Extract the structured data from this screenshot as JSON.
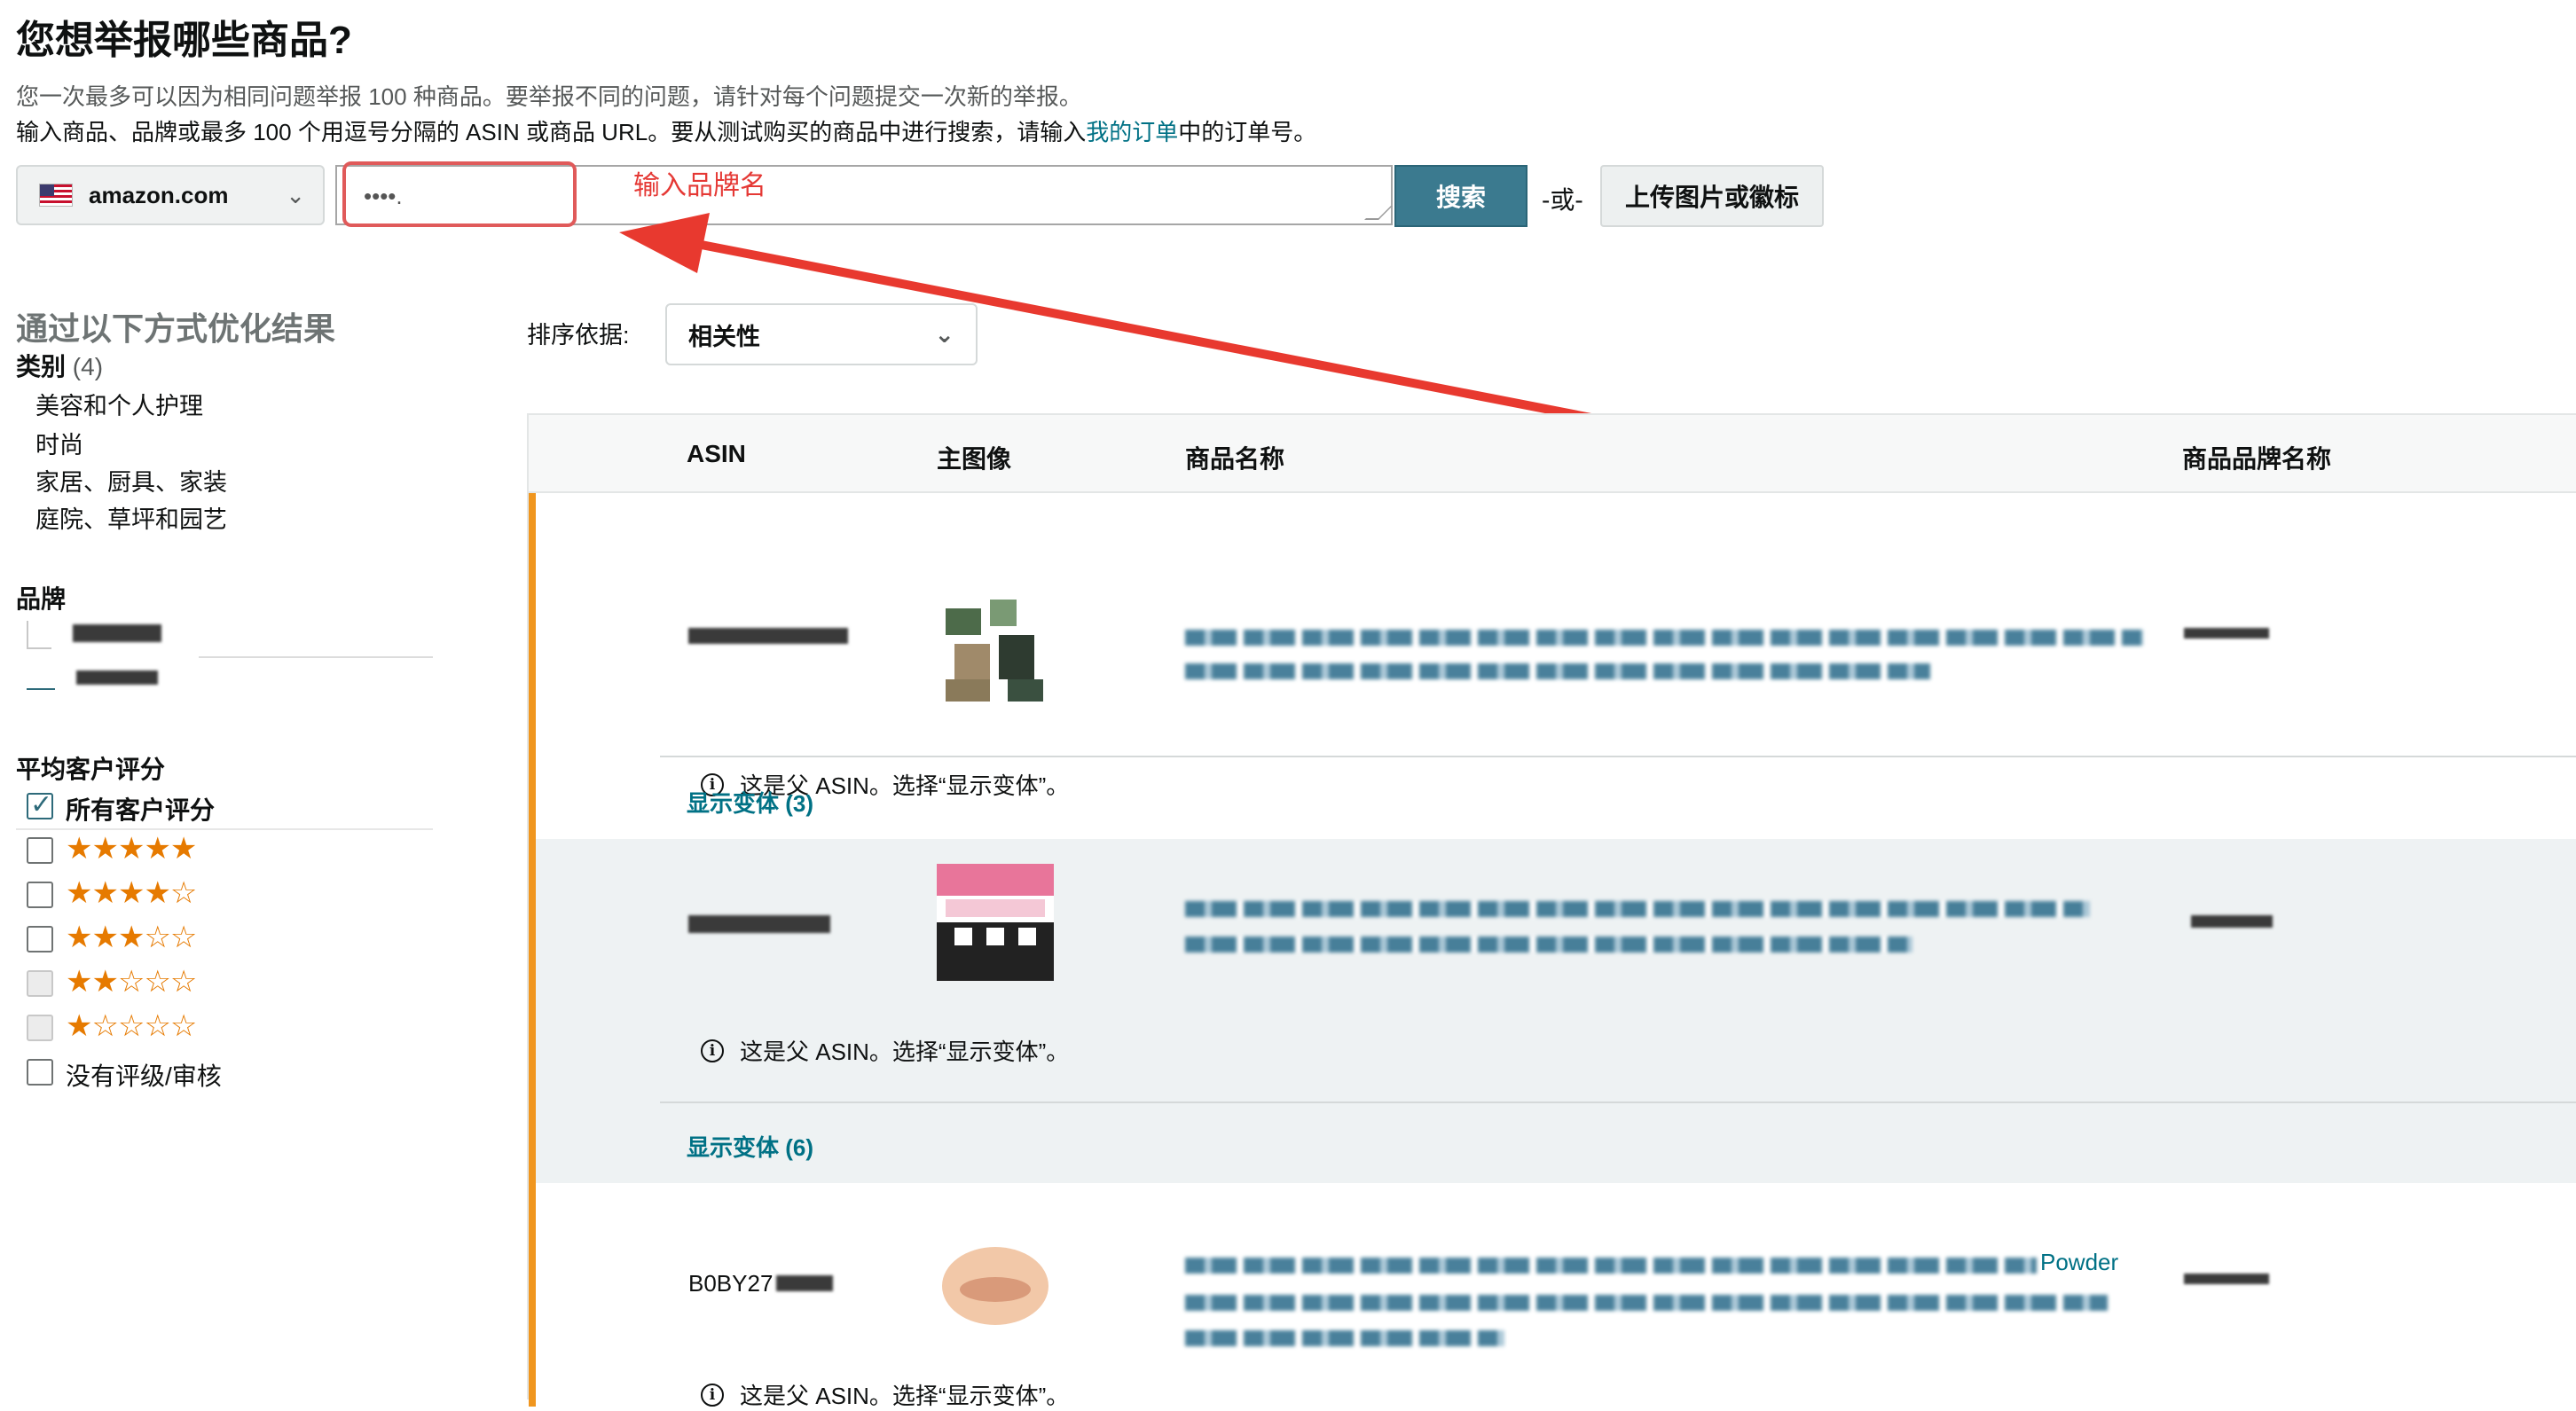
{
  "header": {
    "title": "您想举报哪些商品?",
    "desc1": "您一次最多可以因为相同问题举报 100 种商品。要举报不同的问题，请针对每个问题提交一次新的举报。",
    "desc2_pre": "输入商品、品牌或最多 100 个用逗号分隔的 ASIN 或商品 URL。要从测试购买的商品中进行搜索，请输入",
    "desc2_link": "我的订单",
    "desc2_post": "中的订单号。"
  },
  "search": {
    "marketplace": "amazon.com",
    "query": "••••.",
    "annotation": "输入品牌名",
    "search_label": "搜索",
    "or_label": "-或-",
    "upload_label": "上传图片或徽标"
  },
  "sidebar": {
    "refine_title": "通过以下方式优化结果",
    "category_heading": "类别",
    "category_count": "(4)",
    "categories": [
      "美容和个人护理",
      "时尚",
      "家居、厨具、家装",
      "庭院、草坪和园艺"
    ],
    "brand_heading": "品牌",
    "rating_heading": "平均客户评分",
    "all_ratings": "所有客户评分",
    "rating_stars": [
      "★★★★★",
      "★★★★☆",
      "★★★☆☆",
      "★★☆☆☆",
      "★☆☆☆☆"
    ],
    "no_rating": "没有评级/审核"
  },
  "sort": {
    "label": "排序依据:",
    "value": "相关性"
  },
  "table": {
    "columns": [
      "ASIN",
      "主图像",
      "商品名称",
      "商品品牌名称"
    ],
    "parent_note": "这是父 ASIN。选择“显示变体”。",
    "rows": [
      {
        "asin": "",
        "variants": "显示变体 (3)"
      },
      {
        "asin": "",
        "variants": "显示变体 (6)"
      },
      {
        "asin": "B0BY27",
        "title_tail": "Powder"
      }
    ]
  },
  "colors": {
    "accent_orange": "#f0961f",
    "search_button": "#3b7a8f",
    "link_teal": "#007185",
    "annotation_red": "#e53935",
    "star_orange": "#e67a00"
  }
}
